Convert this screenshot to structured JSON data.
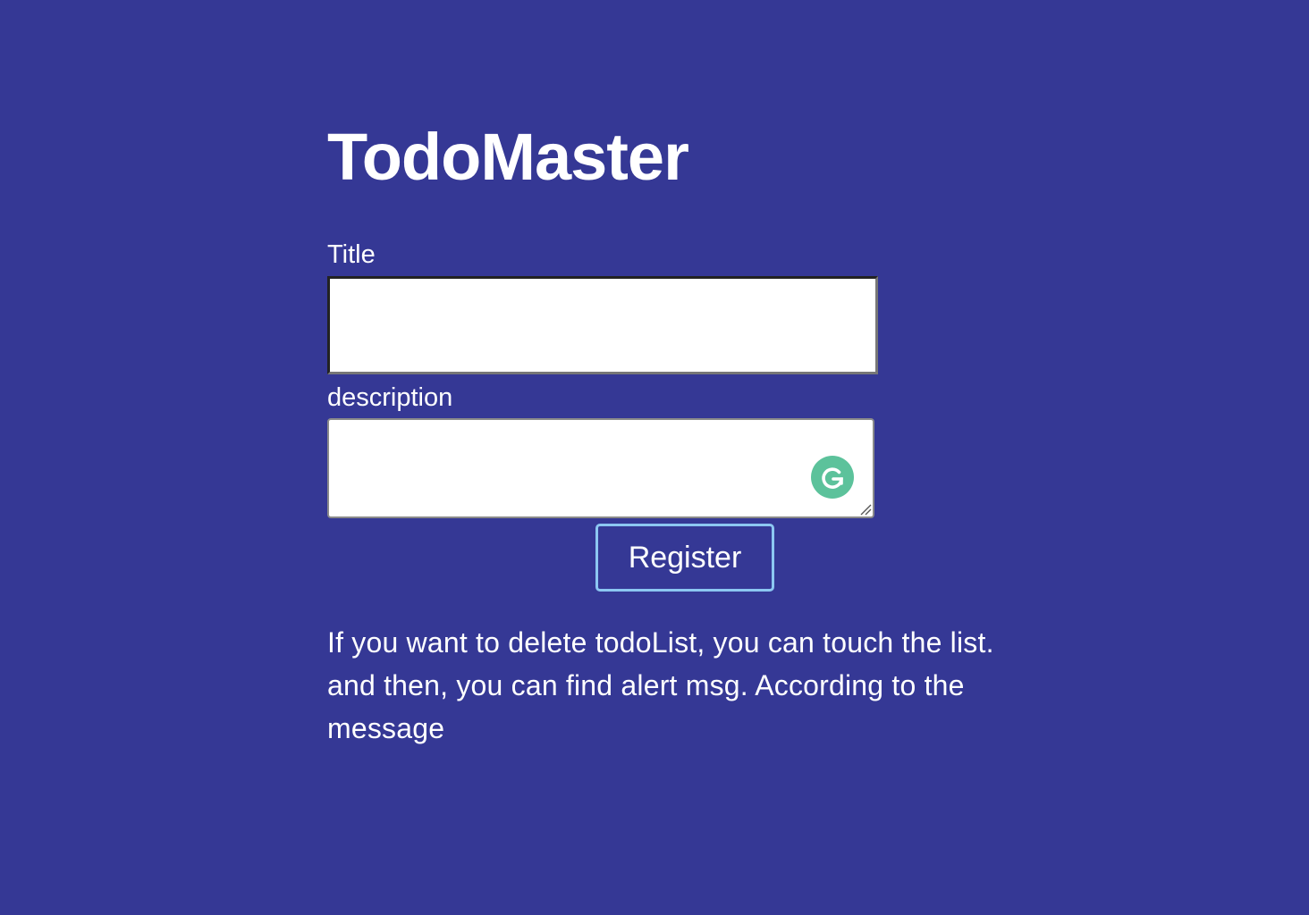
{
  "app": {
    "title": "TodoMaster"
  },
  "form": {
    "title_label": "Title",
    "title_value": "",
    "description_label": "description",
    "description_value": "",
    "register_label": "Register"
  },
  "icons": {
    "grammarly": "grammarly-icon",
    "resize": "resize-handle-icon"
  },
  "help": {
    "text": "If you want to delete todoList, you can touch the list. and then, you can find alert msg. According to the message"
  },
  "colors": {
    "background": "#353895",
    "button_border": "#8cc7f2",
    "grammarly": "#5cc29b"
  }
}
